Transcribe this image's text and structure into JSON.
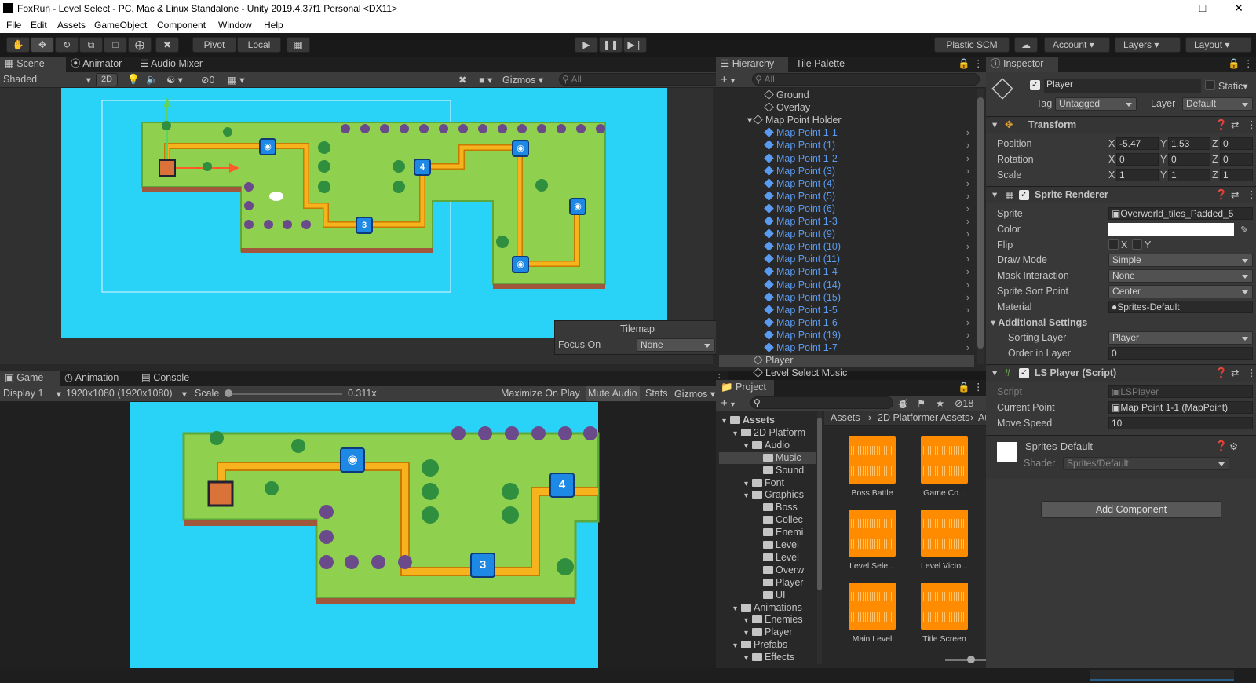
{
  "window": {
    "title": "FoxRun - Level Select - PC, Mac & Linux Standalone - Unity 2019.4.37f1 Personal <DX11>"
  },
  "menu": [
    "File",
    "Edit",
    "Assets",
    "GameObject",
    "Component",
    "Window",
    "Help"
  ],
  "toolbar": {
    "pivot": "Pivot",
    "local": "Local",
    "plastic": "Plastic SCM",
    "account": "Account",
    "layers": "Layers",
    "layout": "Layout"
  },
  "scene": {
    "tabs": [
      "Scene",
      "Animator",
      "Audio Mixer"
    ],
    "shading": "Shaded",
    "mode2d": "2D",
    "hidden_count": "0",
    "gizmos": "Gizmos",
    "search_placeholder": "All",
    "tilemap": {
      "title": "Tilemap",
      "focus_label": "Focus On",
      "focus_value": "None"
    },
    "nodes": [
      "3",
      "4"
    ]
  },
  "game": {
    "tabs": [
      "Game",
      "Animation",
      "Console"
    ],
    "display": "Display 1",
    "resolution": "1920x1080 (1920x1080)",
    "scale_label": "Scale",
    "scale_value": "0.311x",
    "maximize": "Maximize On Play",
    "mute": "Mute Audio",
    "stats": "Stats",
    "gizmos": "Gizmos",
    "nodes": [
      "3",
      "4"
    ]
  },
  "hierarchy": {
    "tabs": [
      "Hierarchy",
      "Tile Palette"
    ],
    "search_placeholder": "All",
    "items": [
      {
        "label": "Ground",
        "indent": 1,
        "type": "obj"
      },
      {
        "label": "Overlay",
        "indent": 1,
        "type": "obj"
      },
      {
        "label": "Map Point Holder",
        "indent": 0,
        "type": "obj",
        "expanded": true
      },
      {
        "label": "Map Point 1-1",
        "indent": 1,
        "type": "mp"
      },
      {
        "label": "Map Point (1)",
        "indent": 1,
        "type": "mp"
      },
      {
        "label": "Map Point 1-2",
        "indent": 1,
        "type": "mp"
      },
      {
        "label": "Map Point (3)",
        "indent": 1,
        "type": "mp"
      },
      {
        "label": "Map Point (4)",
        "indent": 1,
        "type": "mp"
      },
      {
        "label": "Map Point (5)",
        "indent": 1,
        "type": "mp"
      },
      {
        "label": "Map Point (6)",
        "indent": 1,
        "type": "mp"
      },
      {
        "label": "Map Point 1-3",
        "indent": 1,
        "type": "mp"
      },
      {
        "label": "Map Point (9)",
        "indent": 1,
        "type": "mp"
      },
      {
        "label": "Map Point (10)",
        "indent": 1,
        "type": "mp"
      },
      {
        "label": "Map Point (11)",
        "indent": 1,
        "type": "mp"
      },
      {
        "label": "Map Point 1-4",
        "indent": 1,
        "type": "mp"
      },
      {
        "label": "Map Point (14)",
        "indent": 1,
        "type": "mp"
      },
      {
        "label": "Map Point (15)",
        "indent": 1,
        "type": "mp"
      },
      {
        "label": "Map Point 1-5",
        "indent": 1,
        "type": "mp"
      },
      {
        "label": "Map Point 1-6",
        "indent": 1,
        "type": "mp"
      },
      {
        "label": "Map Point (19)",
        "indent": 1,
        "type": "mp"
      },
      {
        "label": "Map Point 1-7",
        "indent": 1,
        "type": "mp"
      },
      {
        "label": "Player",
        "indent": 0,
        "type": "obj",
        "selected": true
      },
      {
        "label": "Level Select Music",
        "indent": 0,
        "type": "obj"
      }
    ]
  },
  "project": {
    "tab": "Project",
    "count": "18",
    "breadcrumb": [
      "Assets",
      "2D Platformer Assets",
      "Audi"
    ],
    "tree": [
      {
        "label": "Assets",
        "level": 0,
        "bold": true
      },
      {
        "label": "2D Platform",
        "level": 1
      },
      {
        "label": "Audio",
        "level": 2
      },
      {
        "label": "Music",
        "level": 3,
        "selected": true
      },
      {
        "label": "Sound",
        "level": 3
      },
      {
        "label": "Font",
        "level": 2
      },
      {
        "label": "Graphics",
        "level": 2
      },
      {
        "label": "Boss",
        "level": 3
      },
      {
        "label": "Collec",
        "level": 3
      },
      {
        "label": "Enemi",
        "level": 3
      },
      {
        "label": "Level",
        "level": 3
      },
      {
        "label": "Level",
        "level": 3
      },
      {
        "label": "Overw",
        "level": 3
      },
      {
        "label": "Player",
        "level": 3
      },
      {
        "label": "UI",
        "level": 3
      },
      {
        "label": "Animations",
        "level": 1
      },
      {
        "label": "Enemies",
        "level": 2
      },
      {
        "label": "Player",
        "level": 2
      },
      {
        "label": "Prefabs",
        "level": 1
      },
      {
        "label": "Effects",
        "level": 2
      }
    ],
    "assets": [
      "Boss Battle",
      "Game Co...",
      "Level Sele...",
      "Level Victo...",
      "Main Level",
      "Title Screen"
    ]
  },
  "inspector": {
    "tab": "Inspector",
    "name": "Player",
    "static_label": "Static",
    "tag_label": "Tag",
    "tag": "Untagged",
    "layer_label": "Layer",
    "layer": "Default",
    "transform": {
      "title": "Transform",
      "position": {
        "label": "Position",
        "x": "-5.47",
        "y": "1.53",
        "z": "0"
      },
      "rotation": {
        "label": "Rotation",
        "x": "0",
        "y": "0",
        "z": "0"
      },
      "scale": {
        "label": "Scale",
        "x": "1",
        "y": "1",
        "z": "1"
      }
    },
    "sprite_renderer": {
      "title": "Sprite Renderer",
      "sprite_label": "Sprite",
      "sprite": "Overworld_tiles_Padded_5",
      "color_label": "Color",
      "flip_label": "Flip",
      "flip_x": "X",
      "flip_y": "Y",
      "draw_mode_label": "Draw Mode",
      "draw_mode": "Simple",
      "mask_label": "Mask Interaction",
      "mask": "None",
      "sort_point_label": "Sprite Sort Point",
      "sort_point": "Center",
      "material_label": "Material",
      "material": "Sprites-Default",
      "additional": "Additional Settings",
      "sorting_layer_label": "Sorting Layer",
      "sorting_layer": "Player",
      "order_label": "Order in Layer",
      "order": "0"
    },
    "ls_player": {
      "title": "LS Player (Script)",
      "script_label": "Script",
      "script": "LSPlayer",
      "current_label": "Current Point",
      "current": "Map Point 1-1 (MapPoint)",
      "speed_label": "Move Speed",
      "speed": "10"
    },
    "material": {
      "name": "Sprites-Default",
      "shader_label": "Shader",
      "shader": "Sprites/Default"
    },
    "add_component": "Add Component"
  },
  "colors": {
    "water": "#29d3f7",
    "grass": "#8fd14f",
    "path": "#f6b31d",
    "node": "#1e88e5",
    "accent_selected": "#2c5d87"
  }
}
